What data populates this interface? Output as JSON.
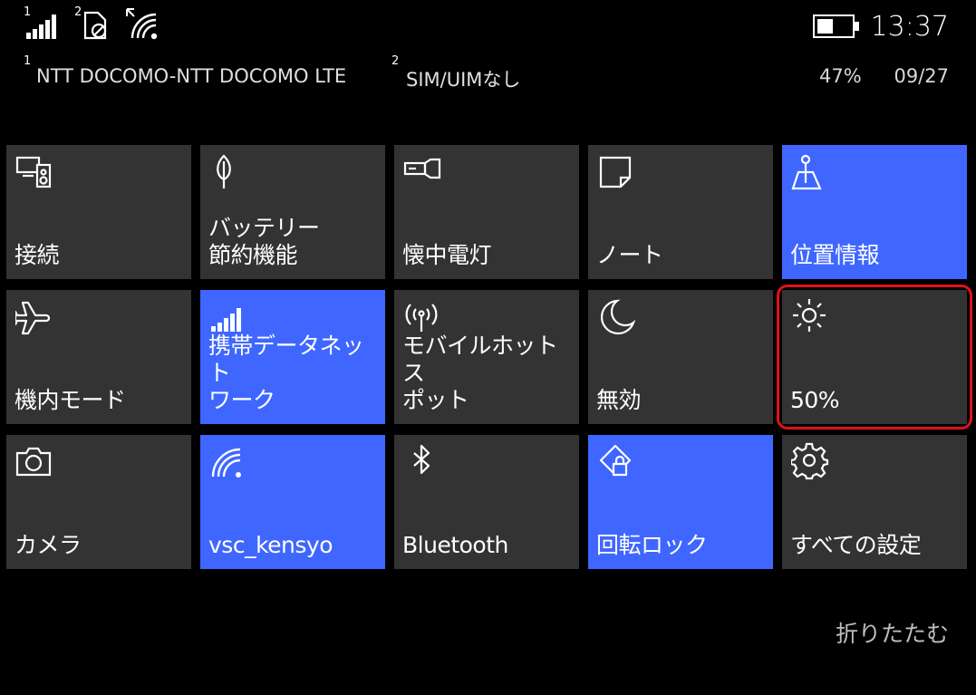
{
  "status": {
    "sim1_num": "1",
    "sim2_num": "2",
    "time": "13:37",
    "battery_percent": "47%",
    "battery_level": 0.47,
    "date": "09/27"
  },
  "carrier": {
    "sim1_num": "1",
    "sim1_name": "NTT DOCOMO-NTT DOCOMO LTE",
    "sim2_num": "2",
    "sim2_name": "SIM/UIMなし"
  },
  "tiles": [
    {
      "id": "connect",
      "label": "接続",
      "icon": "connect-icon",
      "on": false
    },
    {
      "id": "battery-saver",
      "label": "バッテリー\n節約機能",
      "icon": "battery-saver-icon",
      "on": false
    },
    {
      "id": "flashlight",
      "label": "懐中電灯",
      "icon": "flashlight-icon",
      "on": false
    },
    {
      "id": "note",
      "label": "ノート",
      "icon": "note-icon",
      "on": false
    },
    {
      "id": "location",
      "label": "位置情報",
      "icon": "location-icon",
      "on": true
    },
    {
      "id": "airplane",
      "label": "機内モード",
      "icon": "airplane-icon",
      "on": false
    },
    {
      "id": "cellular",
      "label": "携帯データネット\nワーク",
      "icon": "cellular-icon",
      "on": true
    },
    {
      "id": "hotspot",
      "label": "モバイルホットス\nポット",
      "icon": "hotspot-icon",
      "on": false
    },
    {
      "id": "quiet",
      "label": "無効",
      "icon": "moon-icon",
      "on": false
    },
    {
      "id": "brightness",
      "label": "50%",
      "icon": "brightness-icon",
      "on": false,
      "selected": true
    },
    {
      "id": "camera",
      "label": "カメラ",
      "icon": "camera-icon",
      "on": false
    },
    {
      "id": "wifi",
      "label": "vsc_kensyo",
      "icon": "wifi-icon",
      "on": true
    },
    {
      "id": "bluetooth",
      "label": "Bluetooth",
      "icon": "bluetooth-icon",
      "on": false
    },
    {
      "id": "rotation-lock",
      "label": "回転ロック",
      "icon": "rotation-lock-icon",
      "on": true
    },
    {
      "id": "all-settings",
      "label": "すべての設定",
      "icon": "gear-icon",
      "on": false
    }
  ],
  "collapse_label": "折りたたむ",
  "colors": {
    "tile_on": "#3f67ff",
    "tile_off": "#333333",
    "highlight": "#e0111b"
  }
}
